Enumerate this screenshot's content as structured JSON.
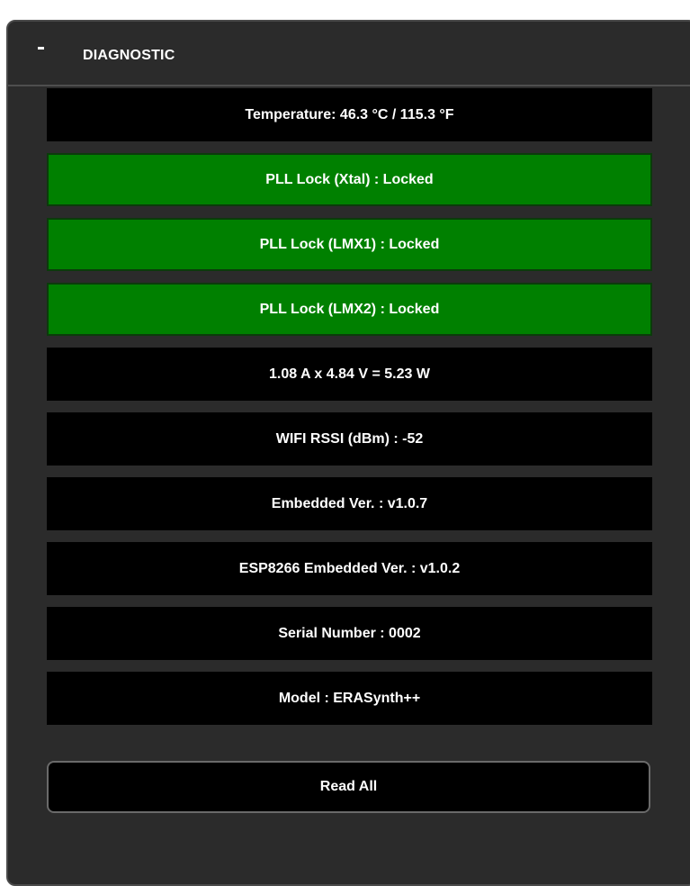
{
  "panel": {
    "toggle_symbol": "-",
    "title": "DIAGNOSTIC"
  },
  "diagnostics": {
    "temperature": "Temperature: 46.3 °C / 115.3 °F",
    "pll_xtal": "PLL Lock (Xtal) : Locked",
    "pll_lmx1": "PLL Lock (LMX1) : Locked",
    "pll_lmx2": "PLL Lock (LMX2) : Locked",
    "power": "1.08 A x 4.84 V = 5.23 W",
    "wifi_rssi": "WIFI RSSI (dBm) : -52",
    "embedded_version": "Embedded Ver. : v1.0.7",
    "esp_version": "ESP8266 Embedded Ver. : v1.0.2",
    "serial_number": "Serial Number : 0002",
    "model": "Model : ERASynth++"
  },
  "actions": {
    "read_all_label": "Read All"
  },
  "colors": {
    "locked_status": "#008000",
    "row_background": "#000000",
    "panel_background": "#2b2b2b"
  }
}
